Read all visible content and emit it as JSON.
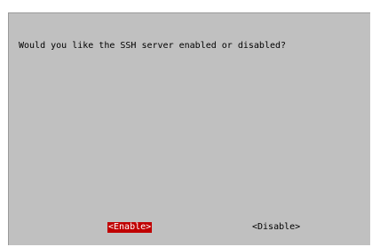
{
  "dialog": {
    "prompt": "Would you like the SSH server enabled or disabled?",
    "buttons": {
      "enable_label": "<Enable>",
      "disable_label": "<Disable>"
    },
    "selected_button": "enable"
  },
  "colors": {
    "dialog_background": "#c0c0c0",
    "selected_button_background": "#c00000",
    "selected_button_text": "#ffffff",
    "text": "#000000",
    "page_background": "#ffffff"
  }
}
